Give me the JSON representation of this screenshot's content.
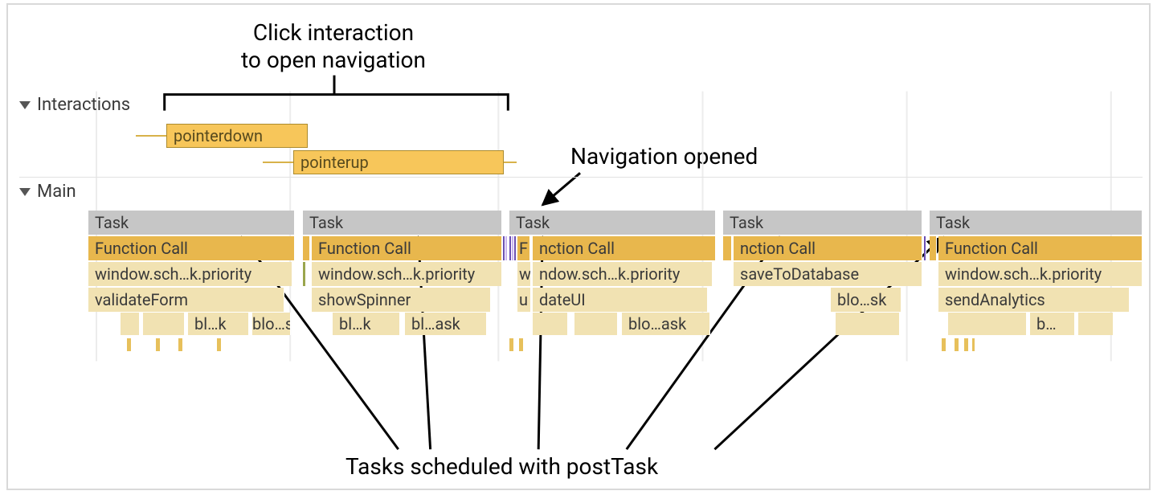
{
  "annotations": {
    "click_interaction_l1": "Click interaction",
    "click_interaction_l2": "to open navigation",
    "navigation_opened": "Navigation opened",
    "tasks_scheduled": "Tasks scheduled with postTask"
  },
  "sections": {
    "interactions": "Interactions",
    "main": "Main"
  },
  "interactions": {
    "pointerdown": "pointerdown",
    "pointerup": "pointerup"
  },
  "labels": {
    "task": "Task",
    "function_call": "Function Call",
    "fc_partial_f": "F",
    "fc_partial_nction": "nction Call",
    "sched": "window.sch…k.priority",
    "sched_partial_w": "w",
    "sched_partial_ndow": "ndow.sch…k.priority",
    "save_db": "saveToDatabase",
    "validate": "validateForm",
    "showspinner": "showSpinner",
    "updateui_partial_u": "u",
    "updateui_partial_dateui": "dateUI",
    "blosk": "blo…sk",
    "blok": "bl…k",
    "bloask": "blo…ask",
    "bltask": "bl…ask",
    "b": "b…",
    "send_analytics": "sendAnalytics"
  }
}
